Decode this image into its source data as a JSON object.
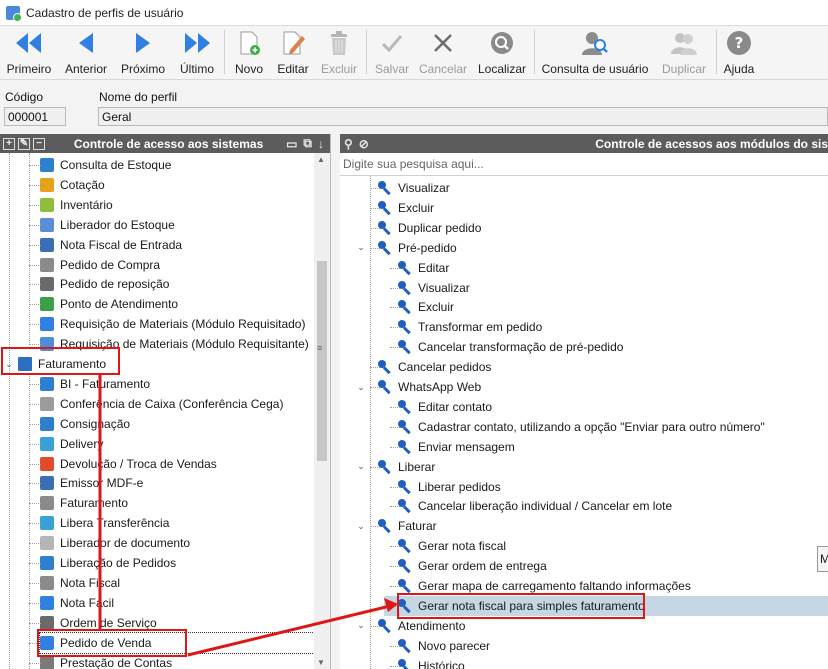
{
  "window": {
    "title": "Cadastro de perfis de usuário"
  },
  "toolbar": {
    "first": "Primeiro",
    "previous": "Anterior",
    "next": "Próximo",
    "last": "Último",
    "new": "Novo",
    "edit": "Editar",
    "delete": "Excluir",
    "save": "Salvar",
    "cancel": "Cancelar",
    "locate": "Localizar",
    "user_query": "Consulta de usuário",
    "duplicate": "Duplicar",
    "help": "Ajuda"
  },
  "fields": {
    "code_label": "Código",
    "code_value": "000001",
    "name_label": "Nome do perfil",
    "name_value": "Geral"
  },
  "left_panel": {
    "header": "Controle de acesso aos sistemas",
    "items": [
      "Consulta de Estoque",
      "Cotação",
      "Inventário",
      "Liberador do Estoque",
      "Nota Fiscal de Entrada",
      "Pedido de Compra",
      "Pedido de reposição",
      "Ponto de Atendimento",
      "Requisição de Materiais (Módulo Requisitado)",
      "Requisição de Materiais (Módulo Requisitante)"
    ],
    "folder": "Faturamento",
    "sub_items": [
      "BI - Faturamento",
      "Conferência de Caixa (Conferência Cega)",
      "Consignação",
      "Delivery",
      "Devolução / Troca de Vendas",
      "Emissor MDF-e",
      "Faturamento",
      "Libera Transferência",
      "Liberador de documento",
      "Liberação de Pedidos",
      "Nota Fiscal",
      "Nota Fácil",
      "Ordem de Serviço",
      "Pedido de Venda",
      "Prestação de Contas"
    ]
  },
  "right_panel": {
    "header": "Controle de acessos aos módulos do sis",
    "search_placeholder": "Digite sua pesquisa aqui...",
    "rows": [
      "Visualizar",
      "Excluir",
      "Duplicar pedido",
      "Pré-pedido",
      "Editar",
      "Visualizar",
      "Excluir",
      "Transformar em pedido",
      "Cancelar transformação de pré-pedido",
      "Cancelar pedidos",
      "WhatsApp Web",
      "Editar contato",
      "Cadastrar contato, utilizando a opção \"Enviar para outro número\"",
      "Enviar mensagem",
      "Liberar",
      "Liberar pedidos",
      "Cancelar liberação individual / Cancelar em lote",
      "Faturar",
      "Gerar nota fiscal",
      "Gerar ordem de entrega",
      "Gerar mapa de carregamento faltando informações",
      "Gerar nota fiscal para simples faturamento",
      "Atendimento",
      "Novo parecer",
      "Histórico"
    ]
  },
  "tooltip": "M",
  "colors": {
    "accent": "#1f6fd6",
    "annotation": "#e01616",
    "selection": "#c5d7e3"
  }
}
